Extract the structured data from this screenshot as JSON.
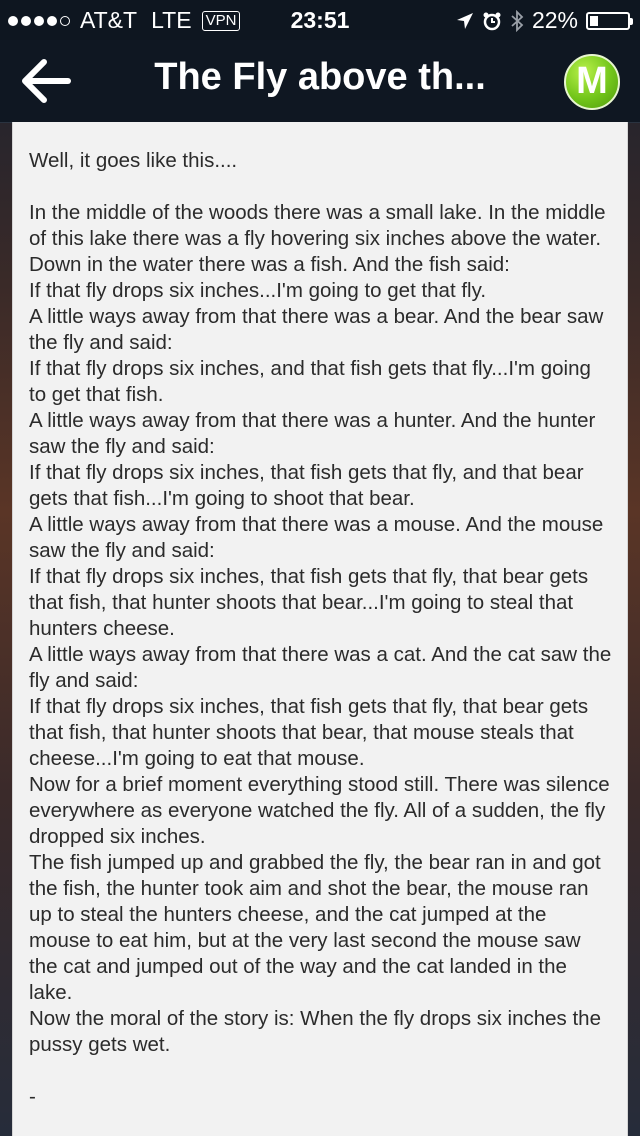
{
  "status_bar": {
    "carrier": "AT&T",
    "network": "LTE",
    "vpn": "VPN",
    "time": "23:51",
    "battery_text": "22%",
    "battery_level": 0.22
  },
  "nav": {
    "title": "The Fly above th...",
    "logo_letter": "M"
  },
  "story": {
    "intro": "Well, it goes like this....",
    "paragraphs": [
      "In the middle of the woods there was a small lake. In the middle of this lake there was a fly hovering six inches above the water.",
      "Down in the water there was a fish. And the fish said:",
      "If that fly drops six inches...I'm going to get that fly.",
      "A little ways away from that there was a bear. And the bear saw the fly and said:",
      "If that fly drops six inches, and that fish gets that fly...I'm going to get that fish.",
      "A little ways away from that there was a hunter. And the hunter saw the fly and said:",
      "If that fly drops six inches, that fish gets that fly, and that bear gets that fish...I'm going to shoot that bear.",
      "A little ways away from that there was a mouse. And the mouse saw the fly and said:",
      "If that fly drops six inches, that fish gets that fly, that bear gets that fish, that hunter shoots that bear...I'm going to steal that hunters cheese.",
      "A little ways away from that there was a cat. And the cat saw the fly and said:",
      "If that fly drops six inches, that fish gets that fly, that bear gets that fish, that hunter shoots that bear, that mouse steals that cheese...I'm going to eat that mouse.",
      "Now for a brief moment everything stood still. There was silence everywhere as everyone watched the fly. All of a sudden, the fly dropped six inches.",
      "The fish jumped up and grabbed the fly, the bear ran in and got the fish, the hunter took aim and shot the bear, the mouse ran up to steal the hunters cheese, and the cat jumped at the mouse to eat him, but at the very last second the mouse saw the cat and jumped out of the way and the cat landed in the lake.",
      "Now the moral of the story is: When the fly drops six inches the pussy gets wet."
    ],
    "trailing": "-"
  }
}
